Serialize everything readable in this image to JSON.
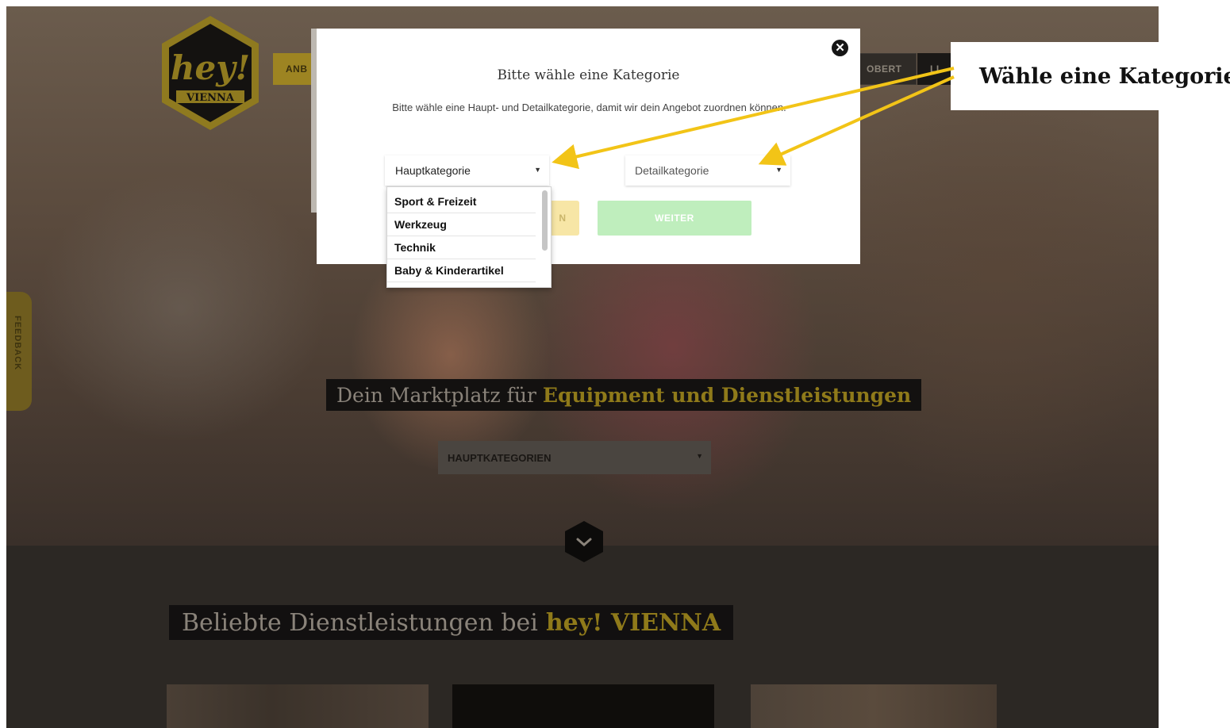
{
  "site": {
    "logo_text": "hey!",
    "logo_subtext": "VIENNA",
    "nav": {
      "anbieten_label": "ANB",
      "login_label": "OBERT",
      "dark_label": "LI"
    },
    "feedback_label": "FEEDBACK",
    "tagline_prefix": "Dein Marktplatz für",
    "tagline_highlight": "Equipment und Dienstleistungen",
    "hero_select_label": "HAUPTKATEGORIEN",
    "section_title_prefix": "Beliebte Dienstleistungen bei",
    "section_title_highlight": "hey! VIENNA"
  },
  "modal": {
    "close_icon": "close-icon",
    "title": "Bitte wähle eine Kategorie",
    "description": "Bitte wähle eine Haupt- und Detailkategorie, damit wir dein Angebot zuordnen können.",
    "main_category_placeholder": "Hauptkategorie",
    "detail_category_placeholder": "Detailkategorie",
    "back_button_label": "N",
    "next_button_label": "WEITER"
  },
  "dropdown": {
    "items": [
      "Sport & Freizeit",
      "Werkzeug",
      "Technik",
      "Baby & Kinderartikel"
    ]
  },
  "annotation": {
    "callout_text": "Wähle eine Kategorie",
    "arrow_color": "#f2c417"
  },
  "colors": {
    "brand_yellow": "#f2c417",
    "overlay_dark": "#2a2521",
    "next_button_green": "#bfeebd",
    "back_button_yellow": "#f7e6a6"
  }
}
